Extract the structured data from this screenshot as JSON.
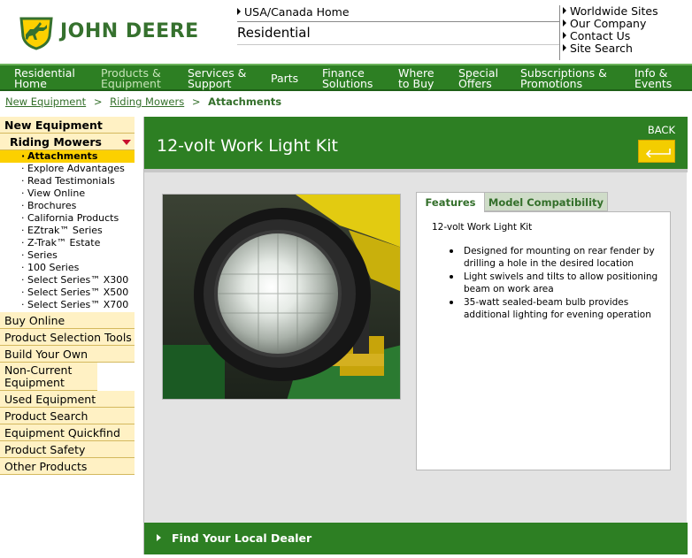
{
  "header": {
    "brand": "JOHN DEERE",
    "usa_link": "USA/Canada Home",
    "section": "Residential",
    "quick_links": [
      "Worldwide Sites",
      "Our Company",
      "Contact Us",
      "Site Search"
    ]
  },
  "nav": {
    "items": [
      {
        "label": "Residential\nHome",
        "active": false
      },
      {
        "label": "Products &\nEquipment",
        "active": true
      },
      {
        "label": "Services &\nSupport",
        "active": false
      },
      {
        "label": "Parts",
        "active": false
      },
      {
        "label": "Finance\nSolutions",
        "active": false
      },
      {
        "label": "Where\nto Buy",
        "active": false
      },
      {
        "label": "Special\nOffers",
        "active": false
      },
      {
        "label": "Subscriptions &\nPromotions",
        "active": false
      },
      {
        "label": "Info &\nEvents",
        "active": false
      }
    ]
  },
  "breadcrumb": {
    "items": [
      "New Equipment",
      "Riding Mowers"
    ],
    "current": "Attachments",
    "separator": ">"
  },
  "sidebar": {
    "heading": "New Equipment",
    "sub_heading": "Riding Mowers",
    "children": [
      {
        "label": "Attachments",
        "active": true
      },
      {
        "label": "Explore Advantages",
        "active": false
      },
      {
        "label": "Read Testimonials",
        "active": false
      },
      {
        "label": "View Online",
        "active": false
      },
      {
        "label": "Brochures",
        "active": false
      },
      {
        "label": "California Products",
        "active": false
      },
      {
        "label": "EZtrak™ Series",
        "active": false
      },
      {
        "label": "Z-Trak™ Estate",
        "active": false
      },
      {
        "label": "Series",
        "active": false
      },
      {
        "label": "100 Series",
        "active": false
      },
      {
        "label": "Select Series™ X300",
        "active": false
      },
      {
        "label": "Select Series™ X500",
        "active": false
      },
      {
        "label": "Select Series™ X700",
        "active": false
      }
    ],
    "items": [
      "Buy Online",
      "Product Selection Tools",
      "Build Your Own",
      "Non-Current Equipment",
      "Used Equipment",
      "Product Search",
      "Equipment Quickfind",
      "Product Safety",
      "Other Products"
    ]
  },
  "content": {
    "title": "12-volt Work Light Kit",
    "back_label": "BACK",
    "tabs": [
      "Features",
      "Model Compatibility"
    ],
    "panel_title": "12-volt Work Light Kit",
    "features": [
      "Designed for mounting on rear fender by drilling a hole in the desired location",
      "Light swivels and tilts to allow positioning beam on work area",
      "35-watt sealed-beam bulb provides additional lighting for evening operation"
    ],
    "dealer_link": "Find Your Local Dealer"
  },
  "colors": {
    "deere_green": "#2d7f23",
    "deere_yellow": "#fcd000",
    "sidebar_cream": "#fff1c4"
  }
}
